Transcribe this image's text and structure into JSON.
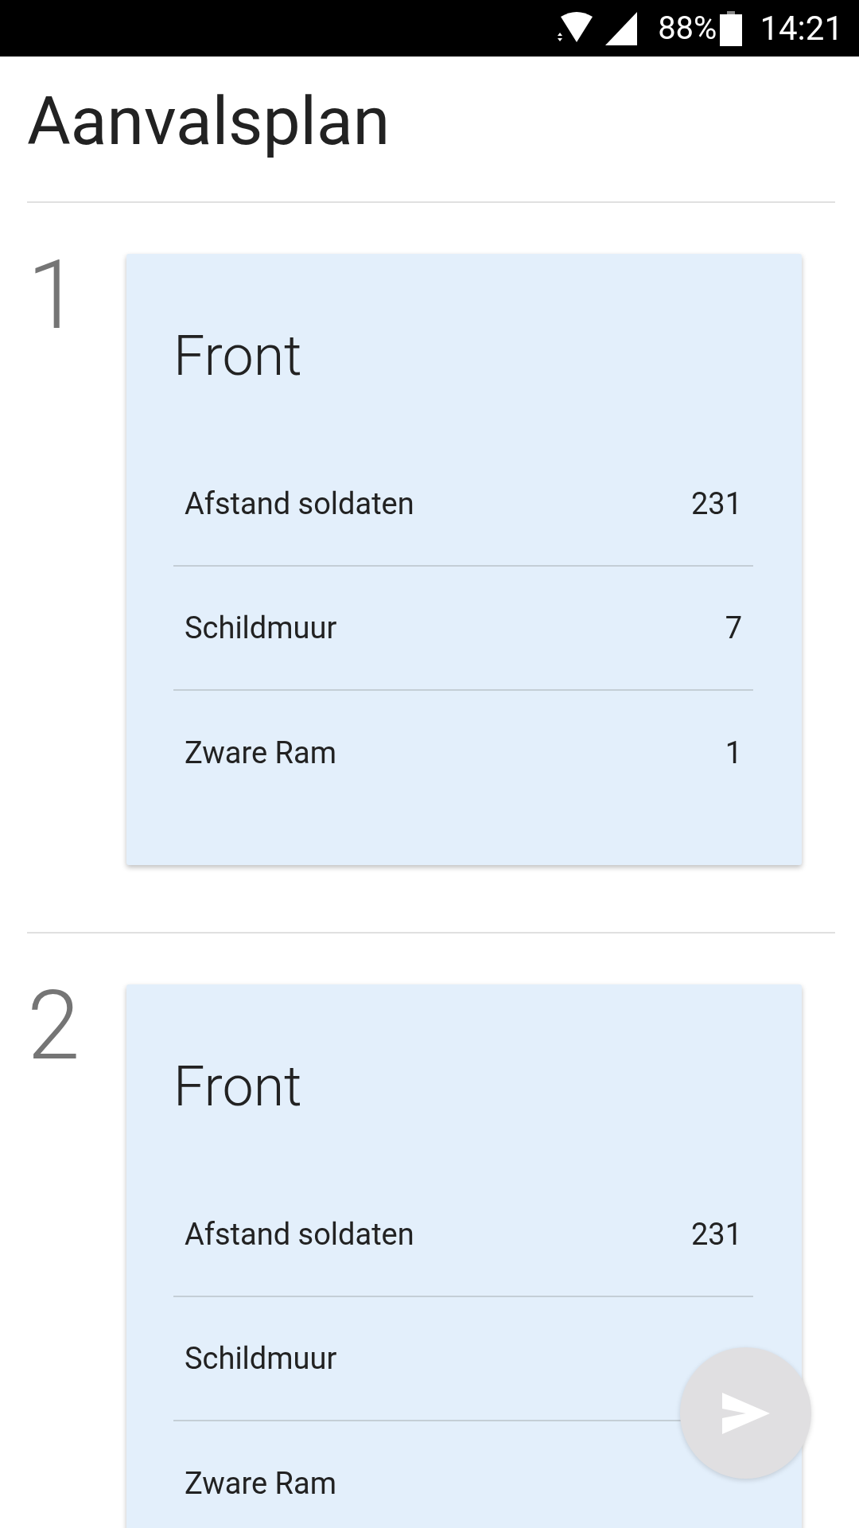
{
  "status_bar": {
    "battery": "88%",
    "time": "14:21"
  },
  "title": "Aanvalsplan",
  "sections": [
    {
      "number": "1",
      "card": {
        "title": "Front",
        "rows": [
          {
            "label": "Afstand soldaten",
            "value": "231"
          },
          {
            "label": "Schildmuur",
            "value": "7"
          },
          {
            "label": "Zware Ram",
            "value": "1"
          }
        ]
      }
    },
    {
      "number": "2",
      "card": {
        "title": "Front",
        "rows": [
          {
            "label": "Afstand soldaten",
            "value": "231"
          },
          {
            "label": "Schildmuur"
          },
          {
            "label": "Zware Ram"
          }
        ]
      }
    }
  ]
}
